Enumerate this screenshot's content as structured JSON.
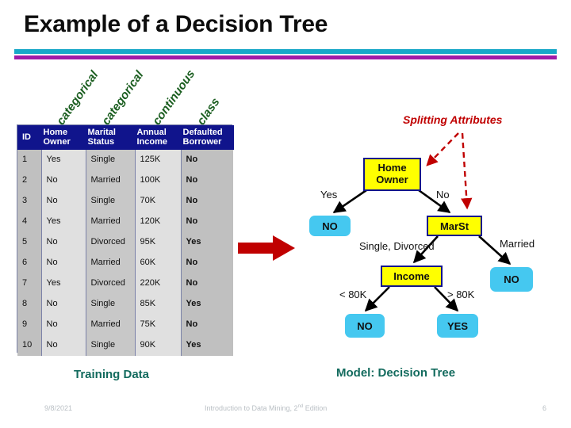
{
  "slide": {
    "title": "Example of a Decision Tree",
    "accent_top": "#18a8c8",
    "accent_bottom": "#a01ba8"
  },
  "column_annotations": [
    {
      "label": "categorical"
    },
    {
      "label": "categorical"
    },
    {
      "label": "continuous"
    },
    {
      "label": "class"
    }
  ],
  "training_table": {
    "caption": "Training Data",
    "headers": [
      "ID",
      "Home Owner",
      "Marital Status",
      "Annual Income",
      "Defaulted Borrower"
    ],
    "header_lines": [
      [
        "ID",
        ""
      ],
      [
        "Home",
        "Owner"
      ],
      [
        "Marital",
        "Status"
      ],
      [
        "Annual",
        "Income"
      ],
      [
        "Defaulted",
        "Borrower"
      ]
    ],
    "rows": [
      {
        "id": "1",
        "home_owner": "Yes",
        "marital_status": "Single",
        "annual_income": "125K",
        "defaulted": "No"
      },
      {
        "id": "2",
        "home_owner": "No",
        "marital_status": "Married",
        "annual_income": "100K",
        "defaulted": "No"
      },
      {
        "id": "3",
        "home_owner": "No",
        "marital_status": "Single",
        "annual_income": "70K",
        "defaulted": "No"
      },
      {
        "id": "4",
        "home_owner": "Yes",
        "marital_status": "Married",
        "annual_income": "120K",
        "defaulted": "No"
      },
      {
        "id": "5",
        "home_owner": "No",
        "marital_status": "Divorced",
        "annual_income": "95K",
        "defaulted": "Yes"
      },
      {
        "id": "6",
        "home_owner": "No",
        "marital_status": "Married",
        "annual_income": "60K",
        "defaulted": "No"
      },
      {
        "id": "7",
        "home_owner": "Yes",
        "marital_status": "Divorced",
        "annual_income": "220K",
        "defaulted": "No"
      },
      {
        "id": "8",
        "home_owner": "No",
        "marital_status": "Single",
        "annual_income": "85K",
        "defaulted": "Yes"
      },
      {
        "id": "9",
        "home_owner": "No",
        "marital_status": "Married",
        "annual_income": "75K",
        "defaulted": "No"
      },
      {
        "id": "10",
        "home_owner": "No",
        "marital_status": "Single",
        "annual_income": "90K",
        "defaulted": "Yes"
      }
    ],
    "header_bg": "#10148c",
    "default_yes_color": "#c00000"
  },
  "tree": {
    "caption": "Model:  Decision Tree",
    "splitting_attributes_label": "Splitting Attributes",
    "internal_fill": "#ffff00",
    "internal_border": "#10148c",
    "leaf_fill": "#45c8f0",
    "nodes": {
      "root": "Home Owner",
      "root_line1": "Home",
      "root_line2": "Owner",
      "leaf_yes": "NO",
      "marst": "MarSt",
      "income": "Income",
      "leaf_lt80k": "NO",
      "leaf_gt80k": "YES",
      "leaf_married": "NO"
    },
    "edges": {
      "yes": "Yes",
      "no": "No",
      "single_divorced": "Single, Divorced",
      "married": "Married",
      "lt_80k": "< 80K",
      "gt_80k": "> 80K"
    }
  },
  "footer": {
    "date": "9/8/2021",
    "center_pre": "Introduction to Data Mining, 2",
    "center_sup": "nd",
    "center_post": " Edition",
    "page": "6"
  }
}
